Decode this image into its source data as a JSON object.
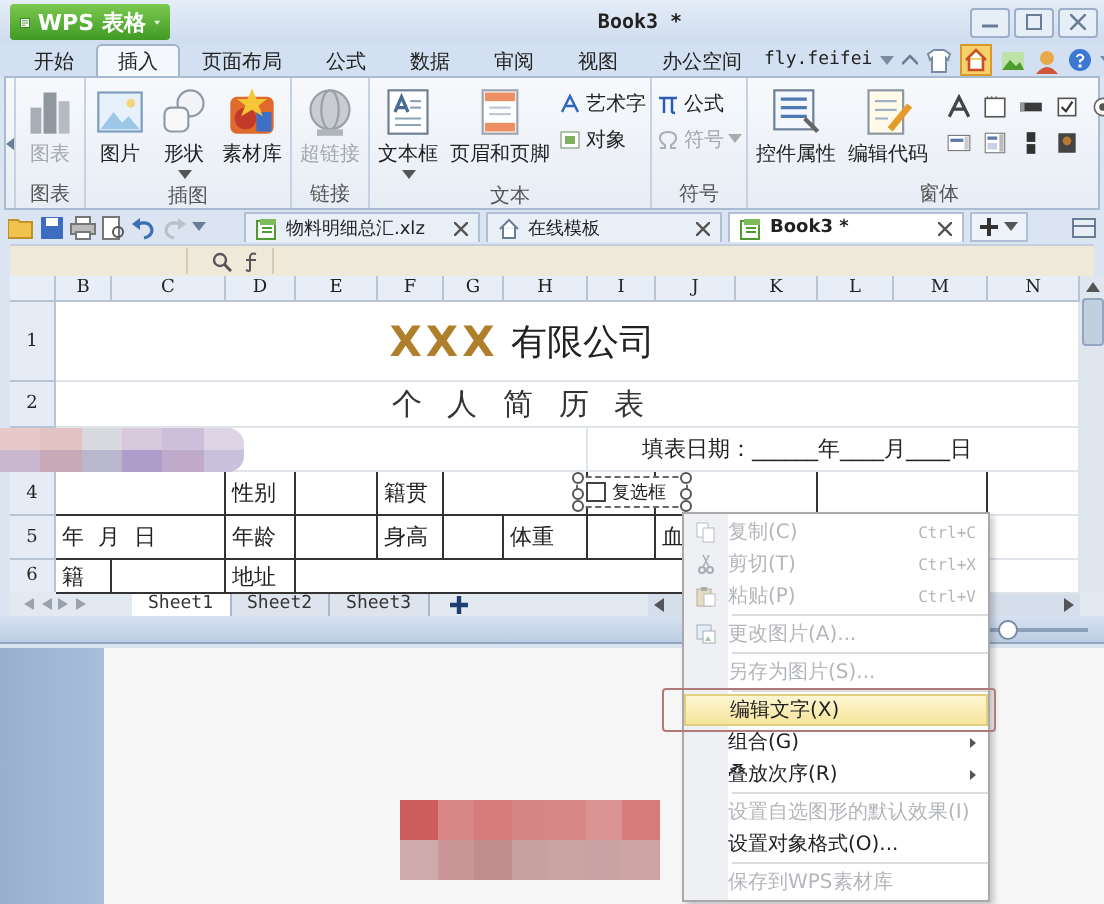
{
  "app_button": {
    "label": "WPS 表格"
  },
  "window": {
    "title": "Book3 *"
  },
  "ribbon_tabs": [
    {
      "label": "开始",
      "selected": false
    },
    {
      "label": "插入",
      "selected": true
    },
    {
      "label": "页面布局",
      "selected": false
    },
    {
      "label": "公式",
      "selected": false
    },
    {
      "label": "数据",
      "selected": false
    },
    {
      "label": "审阅",
      "selected": false
    },
    {
      "label": "视图",
      "selected": false
    },
    {
      "label": "办公空间",
      "selected": false
    }
  ],
  "user": {
    "name": "fly.feifei"
  },
  "ribbon_groups": [
    {
      "label": "图表",
      "items": [
        {
          "label": "图表",
          "kind": "large",
          "disabled": true,
          "dropdown": false
        }
      ]
    },
    {
      "label": "插图",
      "items": [
        {
          "label": "图片",
          "kind": "large",
          "disabled": false,
          "dropdown": false
        },
        {
          "label": "形状",
          "kind": "large",
          "disabled": false,
          "dropdown": true
        },
        {
          "label": "素材库",
          "kind": "large",
          "disabled": false,
          "dropdown": false
        }
      ]
    },
    {
      "label": "链接",
      "items": [
        {
          "label": "超链接",
          "kind": "large",
          "disabled": true,
          "dropdown": false
        }
      ]
    },
    {
      "label": "文本",
      "items": [
        {
          "label": "文本框",
          "kind": "large",
          "disabled": false,
          "dropdown": true
        },
        {
          "label": "页眉和页脚",
          "kind": "large",
          "disabled": false,
          "dropdown": false
        },
        {
          "label": "艺术字",
          "kind": "small",
          "disabled": false,
          "dropdown": false
        },
        {
          "label": "对象",
          "kind": "small",
          "disabled": false,
          "dropdown": false
        }
      ]
    },
    {
      "label": "符号",
      "items": [
        {
          "label": "公式",
          "kind": "small",
          "disabled": false,
          "dropdown": false
        },
        {
          "label": "符号",
          "kind": "small",
          "disabled": true,
          "dropdown": true
        }
      ]
    },
    {
      "label": "窗体",
      "items": [
        {
          "label": "控件属性",
          "kind": "large",
          "disabled": false,
          "dropdown": false
        },
        {
          "label": "编辑代码",
          "kind": "large",
          "disabled": false,
          "dropdown": false
        },
        {
          "kind": "icon-grid"
        }
      ]
    }
  ],
  "doc_tabs": [
    {
      "label": "物料明细总汇.xlz",
      "selected": false
    },
    {
      "label": "在线模板",
      "selected": false
    },
    {
      "label": "Book3 *",
      "selected": true
    }
  ],
  "columns": [
    "B",
    "C",
    "D",
    "E",
    "F",
    "G",
    "H",
    "I",
    "J",
    "K",
    "L",
    "M",
    "N"
  ],
  "rows": [
    {
      "number": "1",
      "cells": [
        {
          "mark": "XXX",
          "text": "有限公司"
        }
      ]
    },
    {
      "number": "2",
      "cells": [
        {
          "text": "个 人 简 历 表"
        }
      ]
    },
    {
      "cells": [
        {
          "text": "填表日期：______年____月____日"
        }
      ]
    },
    {
      "number": "4",
      "cells": [
        {
          "text": "性别"
        },
        {
          "text": "籍贯"
        }
      ],
      "checkbox_control": {
        "label": "复选框",
        "checked": false,
        "selected": true
      }
    },
    {
      "number": "5",
      "cells": [
        {
          "text": "年  月  日"
        },
        {
          "text": "年龄"
        },
        {
          "text": "身高"
        },
        {
          "text": "体重"
        },
        {
          "text": "血"
        }
      ]
    },
    {
      "number": "6",
      "cells": [
        {
          "text": "籍"
        },
        {
          "text": "地址"
        }
      ]
    }
  ],
  "sheet_tabs": [
    {
      "label": "Sheet1",
      "selected": true
    },
    {
      "label": "Sheet2",
      "selected": false
    },
    {
      "label": "Sheet3",
      "selected": false
    }
  ],
  "zoom_slider": {
    "level": 0.2
  },
  "context_menu": {
    "items": [
      {
        "label": "复制(C)",
        "shortcut": "Ctrl+C",
        "disabled": true,
        "selected": false,
        "submenu": false,
        "separator_after": false
      },
      {
        "label": "剪切(T)",
        "shortcut": "Ctrl+X",
        "disabled": true,
        "selected": false,
        "submenu": false,
        "separator_after": false
      },
      {
        "label": "粘贴(P)",
        "shortcut": "Ctrl+V",
        "disabled": true,
        "selected": false,
        "submenu": false,
        "separator_after": true
      },
      {
        "label": "更改图片(A)...",
        "disabled": true,
        "selected": false,
        "submenu": false,
        "separator_after": true
      },
      {
        "label": "另存为图片(S)...",
        "disabled": true,
        "selected": false,
        "submenu": false,
        "separator_after": true
      },
      {
        "label": "编辑文字(X)",
        "disabled": false,
        "selected": true,
        "submenu": false,
        "separator_after": false
      },
      {
        "label": "组合(G)",
        "disabled": false,
        "selected": false,
        "submenu": true,
        "separator_after": false
      },
      {
        "label": "叠放次序(R)",
        "disabled": false,
        "selected": false,
        "submenu": true,
        "separator_after": true
      },
      {
        "label": "设置自选图形的默认效果(I)",
        "disabled": true,
        "selected": false,
        "submenu": false,
        "separator_after": false
      },
      {
        "label": "设置对象格式(O)...",
        "disabled": false,
        "selected": false,
        "submenu": false,
        "separator_after": true
      },
      {
        "label": "保存到WPS素材库",
        "disabled": true,
        "selected": false,
        "submenu": false,
        "separator_after": false
      }
    ]
  }
}
